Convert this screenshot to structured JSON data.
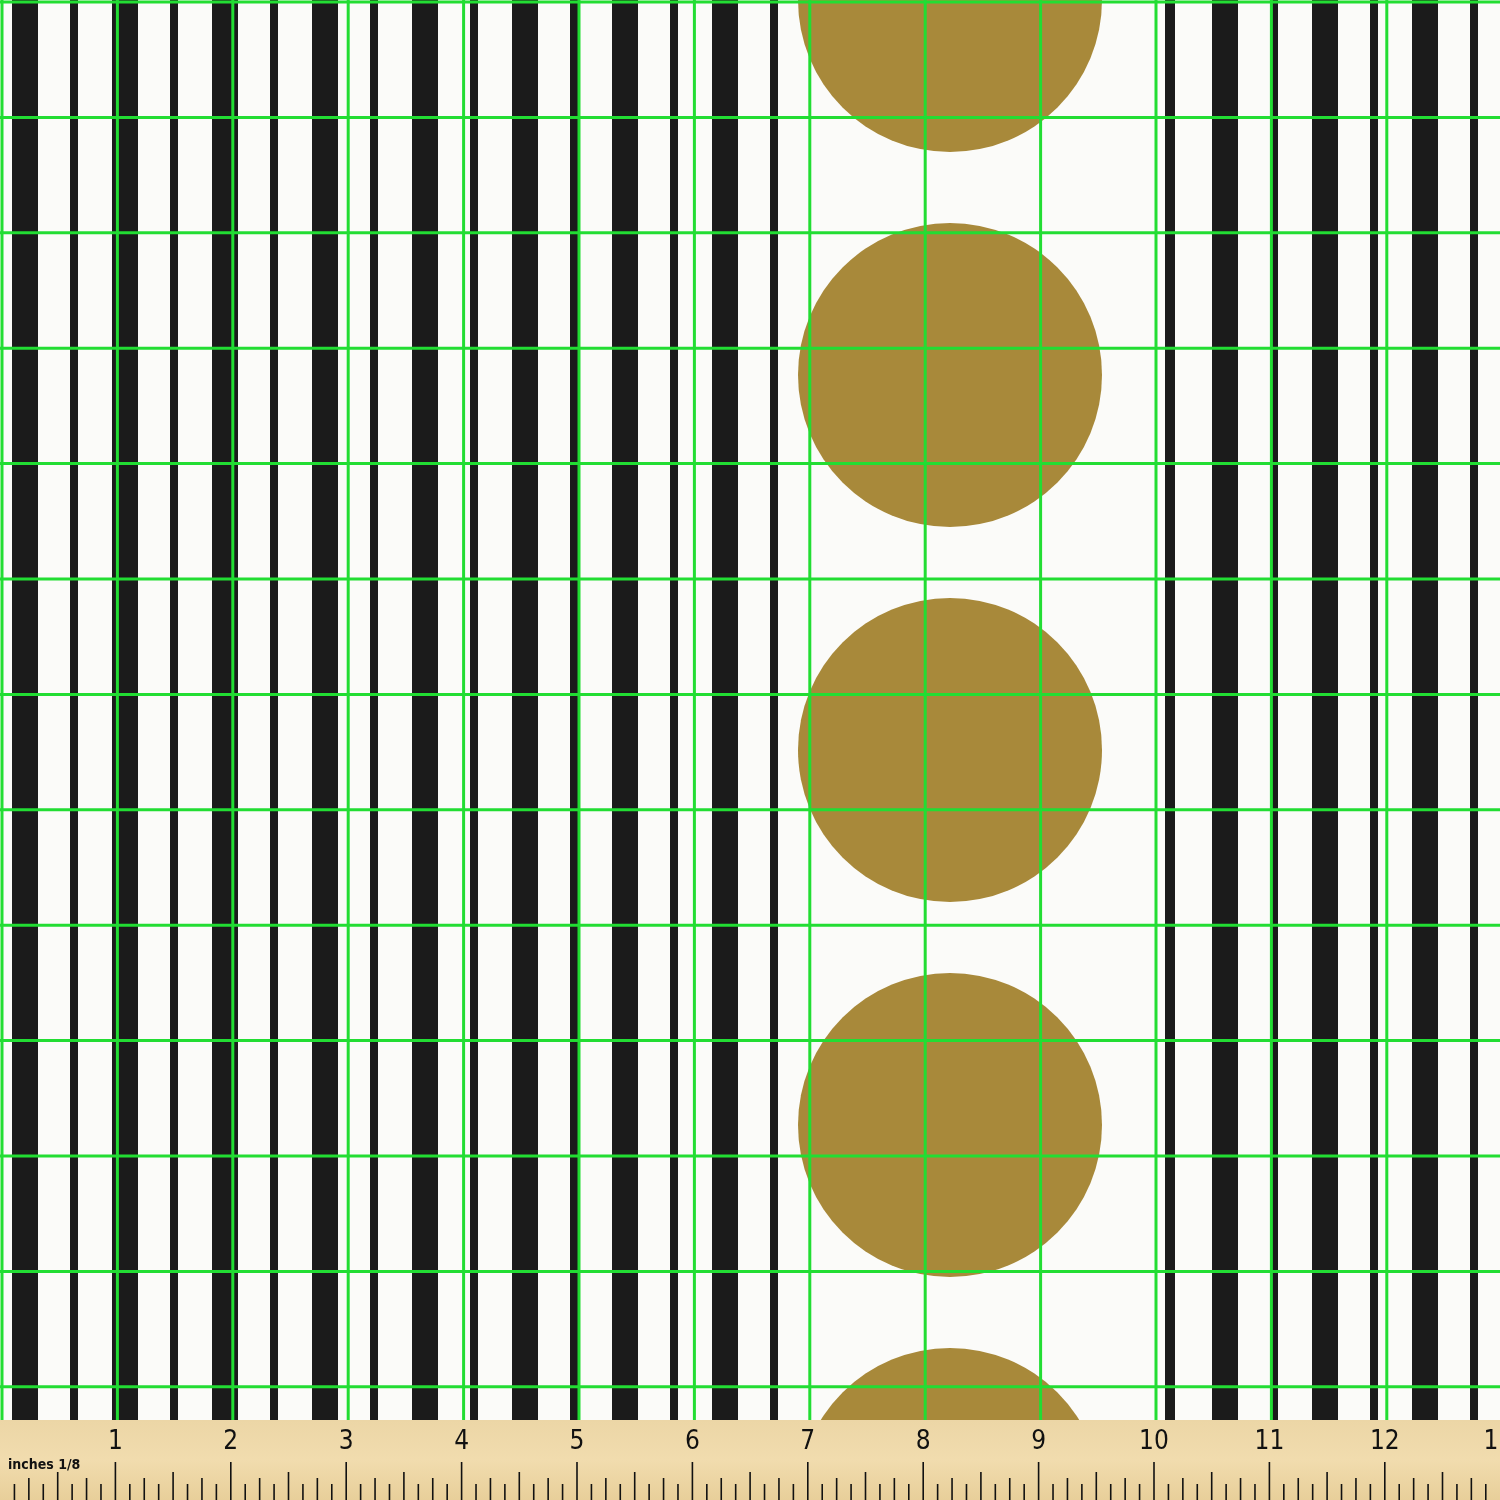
{
  "ruler": {
    "unit_label": "inches 1/8",
    "numbers": [
      "1",
      "2",
      "3",
      "4",
      "5",
      "6",
      "7",
      "8",
      "9",
      "10",
      "11",
      "12",
      "1"
    ]
  }
}
